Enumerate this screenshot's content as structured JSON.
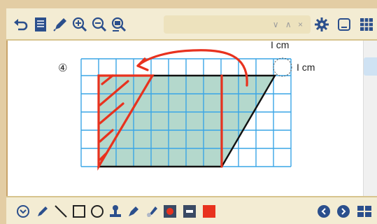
{
  "toolbar": {
    "search": {
      "value": "",
      "controls": "∨ ∧ ×"
    },
    "icons": [
      "undo-icon",
      "page-list-icon",
      "pen-icon",
      "zoom-in-icon",
      "zoom-out-icon",
      "zoom-fit-icon",
      "gear-icon",
      "minimize-icon",
      "grid-icon"
    ]
  },
  "figure": {
    "problem_number": "④",
    "scale_label_top": "I cm",
    "scale_label_right": "I cm"
  },
  "bottombar": {
    "icons": [
      "menu-expand-icon",
      "pen-icon",
      "line-icon",
      "rectangle-icon",
      "circle-icon",
      "stamp-icon",
      "marker-icon",
      "eraser-icon",
      "record-icon",
      "film-icon",
      "red-square-icon",
      "prev-page-icon",
      "next-page-icon",
      "layout-icon"
    ]
  },
  "colors": {
    "grid": "#3aa6e6",
    "fill": "#b4d8cc",
    "annotation": "#e8321e",
    "outline": "#111111",
    "toolbar_icon": "#2b4f8c"
  }
}
